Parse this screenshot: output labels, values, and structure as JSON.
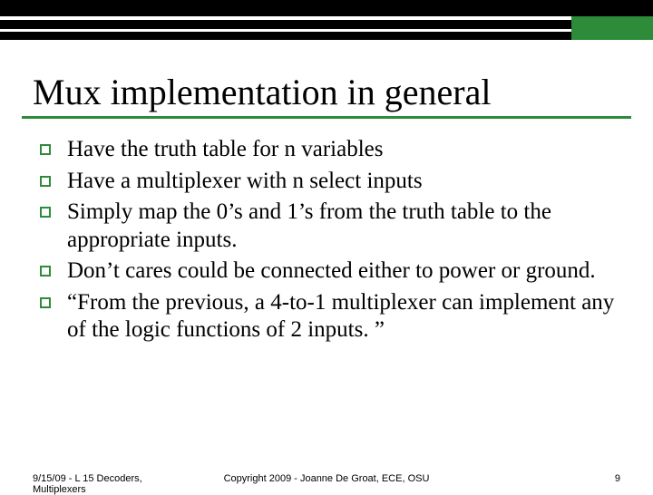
{
  "title": "Mux implementation in general",
  "bullets": [
    "Have the truth table for n variables",
    "Have a multiplexer with n select inputs",
    "Simply map the 0’s and 1’s from the truth table to the appropriate inputs.",
    "Don’t cares could be connected either to power or ground.",
    "“From the previous, a 4-to-1 multiplexer can implement any of the logic functions of 2 inputs. ”"
  ],
  "footer": {
    "left_line1": "9/15/09 - L 15 Decoders,",
    "left_line2": "Multiplexers",
    "center": "Copyright 2009 - Joanne De Groat, ECE, OSU",
    "right": "9"
  },
  "colors": {
    "accent": "#2e8b3a"
  }
}
